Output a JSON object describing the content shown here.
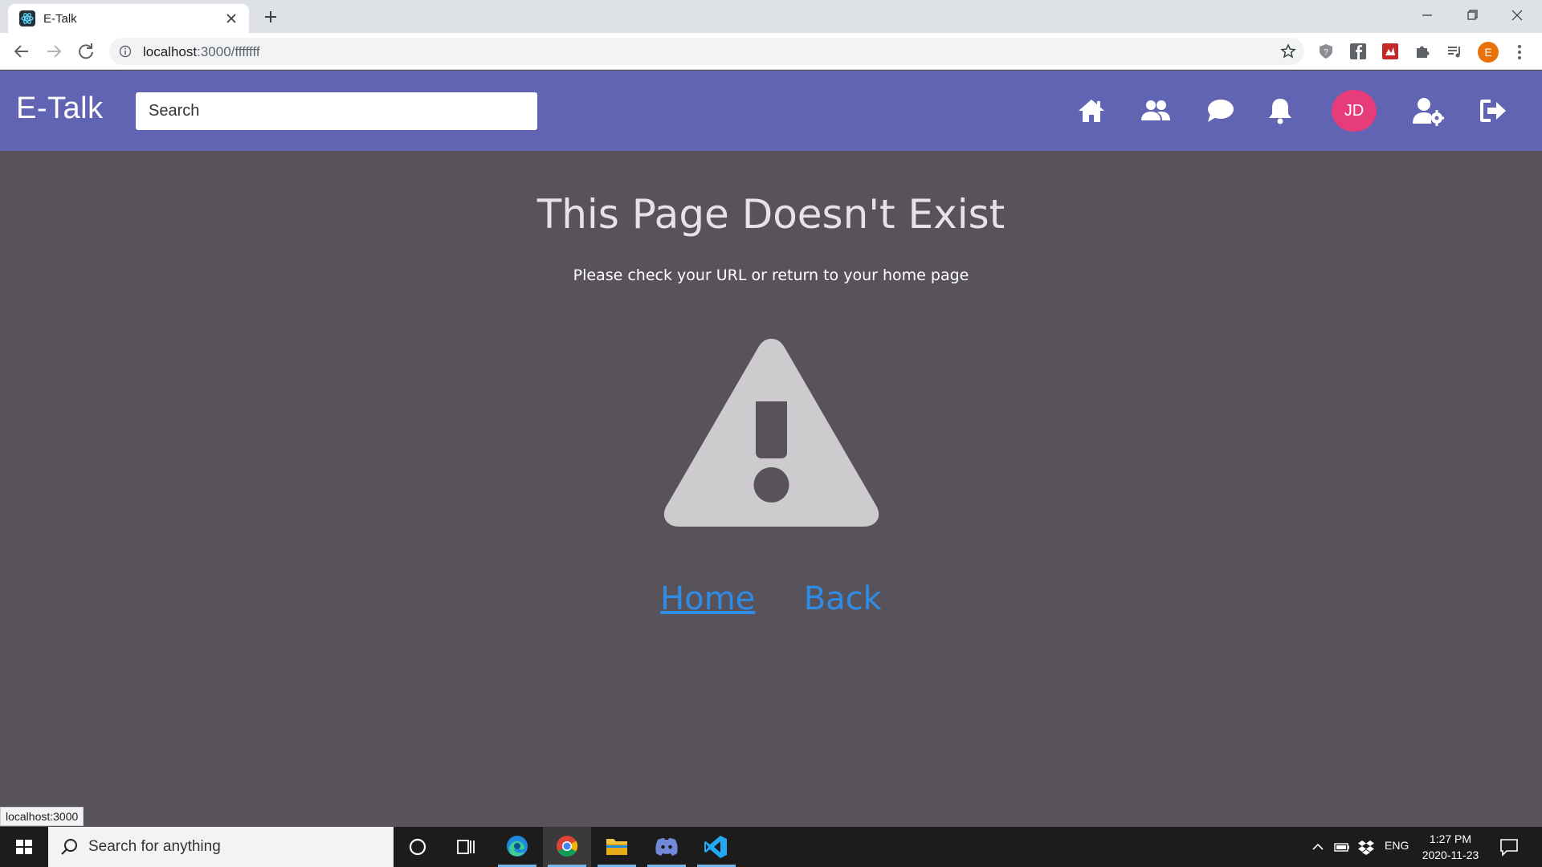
{
  "browser": {
    "tab_title": "E-Talk",
    "url_host": "localhost",
    "url_rest": ":3000/fffffff",
    "profile_initial": "E"
  },
  "app": {
    "brand": "E-Talk",
    "search_placeholder": "Search",
    "avatar_initials": "JD",
    "nav_icons": [
      "home-icon",
      "friends-icon",
      "chat-icon",
      "bell-icon",
      "user-settings-icon",
      "logout-icon"
    ],
    "header_color": "#6163b3",
    "avatar_color": "#e63c7a"
  },
  "main": {
    "title": "This Page Doesn't Exist",
    "subtitle": "Please check your URL or return to your home page",
    "home_link": "Home",
    "back_link": "Back",
    "link_color": "#2f8ce6",
    "background_color": "#58535b"
  },
  "status_url": "localhost:3000",
  "taskbar": {
    "search_placeholder": "Search for anything",
    "language": "ENG",
    "time": "1:27 PM",
    "date": "2020-11-23"
  }
}
